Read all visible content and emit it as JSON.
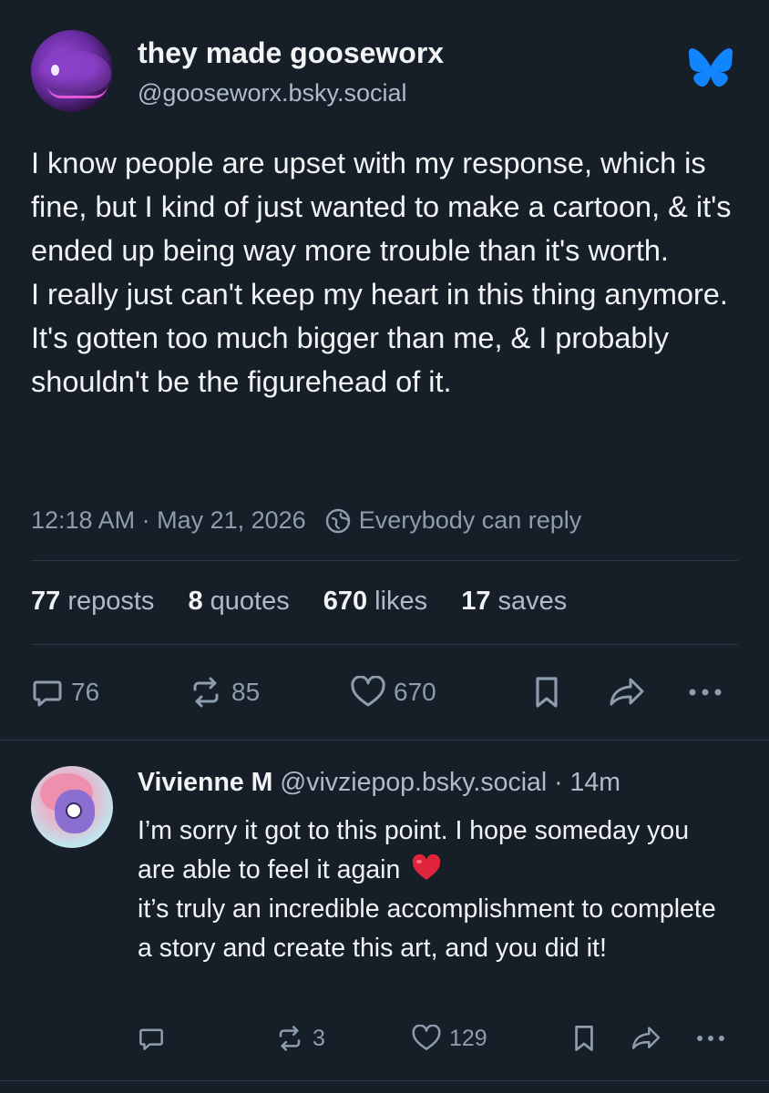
{
  "post": {
    "display_name": "they made gooseworx",
    "handle": "@gooseworx.bsky.social",
    "text_paragraphs": [
      "I know people are upset with my response, which is fine, but I kind of just wanted to make a cartoon, & it's ended up being way more trouble than it's worth.",
      "I really just can't keep my heart in this thing anymore. It's gotten too much bigger than me, & I probably shouldn't be the figurehead of it."
    ],
    "timestamp": "12:18 AM · May 21, 2026",
    "reply_setting": "Everybody can reply",
    "stats": {
      "reposts_count": "77",
      "reposts_label": "reposts",
      "quotes_count": "8",
      "quotes_label": "quotes",
      "likes_count": "670",
      "likes_label": "likes",
      "saves_count": "17",
      "saves_label": "saves"
    },
    "actions": {
      "reply_count": "76",
      "repost_count": "85",
      "like_count": "670"
    }
  },
  "reply": {
    "display_name": "Vivienne M",
    "handle": "@vivziepop.bsky.social",
    "age": "· 14m",
    "text_line1": "I’m sorry it got to this point. I hope someday you are able to feel it again",
    "text_line2": "it’s truly an incredible accomplishment to complete a story and create this art, and you did it!",
    "actions": {
      "repost_count": "3",
      "like_count": "129"
    }
  },
  "colors": {
    "background": "#161e27",
    "text_primary": "#f1f3f5",
    "text_secondary": "#aebbc9",
    "icon_muted": "#8d9dae",
    "bluesky_blue": "#1185fe"
  },
  "icons": [
    "bluesky-butterfly-icon",
    "globe-icon",
    "reply-icon",
    "repost-icon",
    "heart-icon",
    "bookmark-icon",
    "share-icon",
    "more-icon",
    "red-heart-emoji"
  ]
}
